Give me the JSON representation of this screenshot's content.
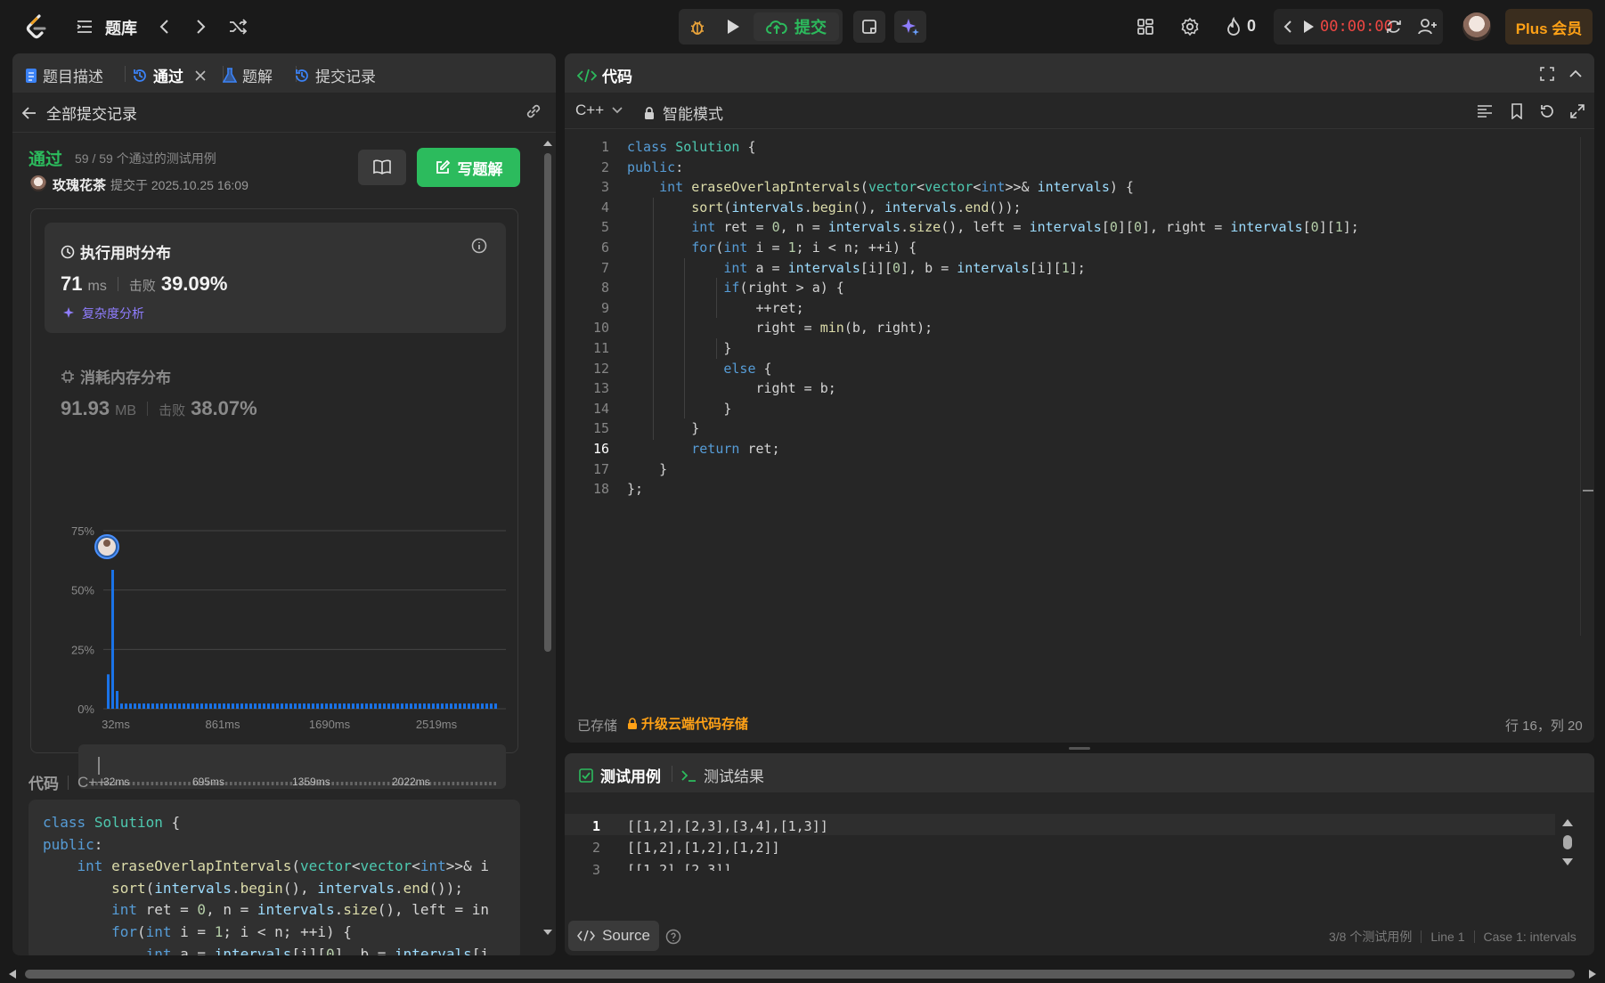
{
  "topbar": {
    "problem_bank": "题库",
    "submit": "提交",
    "streak_count": "0",
    "timer": "00:00:00",
    "plus": "Plus 会员"
  },
  "left_tabs": {
    "description": "题目描述",
    "passed": "通过",
    "solutions": "题解",
    "submissions": "提交记录"
  },
  "left": {
    "back_label": "全部提交记录",
    "status": "通过",
    "cases": "59 / 59 个通过的测试用例",
    "user": "玫瑰花茶",
    "submitted_at": "提交于 2025.10.25 16:09",
    "write_solution": "写题解",
    "runtime_title": "执行用时分布",
    "runtime_value": "71",
    "runtime_unit": "ms",
    "beats_label": "击败",
    "runtime_beats": "39.09%",
    "complexity": "复杂度分析",
    "memory_title": "消耗内存分布",
    "memory_value": "91.93",
    "memory_unit": "MB",
    "memory_beats_label": "击败",
    "memory_beats": "38.07%",
    "code_label": "代码",
    "code_lang": "C++"
  },
  "chart_data": {
    "type": "bar",
    "title": "",
    "xlabel": "",
    "ylabel": "",
    "ylim": [
      0,
      75
    ],
    "y_ticks": [
      "75%",
      "50%",
      "25%",
      "0%"
    ],
    "x_ticks": [
      "32ms",
      "861ms",
      "1690ms",
      "2519ms"
    ],
    "values": [
      14.5,
      58.5,
      7.5,
      2.2,
      2.2,
      2.2,
      2.2,
      2.2,
      2.2,
      2.2,
      2.2,
      2.2,
      2.2,
      2.2,
      2.2,
      2.2,
      2.2,
      2.2,
      2.2,
      2.2,
      2.2,
      2.2,
      2.2,
      2.2,
      2.2,
      2.2,
      2.2,
      2.2,
      2.2,
      2.2,
      2.2,
      2.2,
      2.2,
      2.2,
      2.2,
      2.2,
      2.2,
      2.2,
      2.2,
      2.2,
      2.2,
      2.2,
      2.2,
      2.2,
      2.2,
      2.2,
      2.2,
      2.2,
      2.2,
      2.2,
      2.2,
      2.2,
      2.2,
      2.2,
      2.2,
      2.2,
      2.2,
      2.2,
      2.2,
      2.2,
      2.2,
      2.2,
      2.2,
      2.2,
      2.2,
      2.2,
      2.2,
      2.2,
      2.2,
      2.2,
      2.2,
      2.2,
      2.2,
      2.2,
      2.2,
      2.2,
      2.2,
      2.2,
      2.2,
      2.2,
      2.2,
      2.2,
      2.2,
      2.2,
      2.2,
      2.2,
      2.2,
      2.2
    ],
    "color": "#1a73e8",
    "minimap_ticks": [
      "32ms",
      "695ms",
      "1359ms",
      "2022ms"
    ]
  },
  "editor": {
    "title": "代码",
    "lang": "C++",
    "mode": "智能模式",
    "saved": "已存储",
    "upgrade": "升级云端代码存储",
    "position": "行 16，列 20"
  },
  "code": [
    "class Solution {",
    "public:",
    "    int eraseOverlapIntervals(vector<vector<int>>& intervals) {",
    "        sort(intervals.begin(), intervals.end());",
    "        int ret = 0, n = intervals.size(), left = intervals[0][0], right = intervals[0][1];",
    "        for(int i = 1; i < n; ++i) {",
    "            int a = intervals[i][0], b = intervals[i][1];",
    "            if(right > a) {",
    "                ++ret;",
    "                right = min(b, right);",
    "            }",
    "            else {",
    "                right = b;",
    "            }",
    "        }",
    "        return ret;",
    "    }",
    "};"
  ],
  "left_code": [
    "class Solution {",
    "public:",
    "    int eraseOverlapIntervals(vector<vector<int>>& i",
    "        sort(intervals.begin(), intervals.end());",
    "        int ret = 0, n = intervals.size(), left = in",
    "        for(int i = 1; i < n; ++i) {",
    "            int a = intervals[i][0], b = intervals[i"
  ],
  "testcase": {
    "tab_cases": "测试用例",
    "tab_results": "测试结果",
    "lines": [
      "[[1,2],[2,3],[3,4],[1,3]]",
      "[[1,2],[1,2],[1,2]]",
      "[[1,2],[2,3]]"
    ],
    "source": "Source",
    "status": "3/8 个测试用例",
    "line": "Line 1",
    "case": "Case 1: intervals"
  }
}
